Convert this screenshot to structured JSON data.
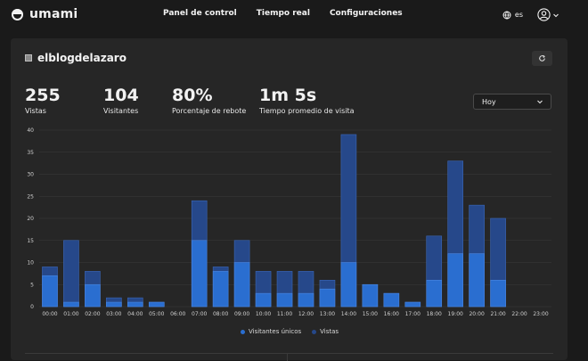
{
  "app": {
    "name": "umami"
  },
  "nav": {
    "items": [
      "Panel de control",
      "Tiempo real",
      "Configuraciones"
    ]
  },
  "tools": {
    "lang": "es"
  },
  "site": {
    "name": "elblogdelazaro"
  },
  "metrics": [
    {
      "value": "255",
      "label": "Vistas"
    },
    {
      "value": "104",
      "label": "Visitantes"
    },
    {
      "value": "80%",
      "label": "Porcentaje de rebote"
    },
    {
      "value": "1m 5s",
      "label": "Tiempo promedio de visita"
    }
  ],
  "range": {
    "selected": "Hoy"
  },
  "colors": {
    "unique": "#2a6ed0",
    "views": "#26488a",
    "grid": "#3a3a3a"
  },
  "chart_data": {
    "type": "bar",
    "categories": [
      "00:00",
      "01:00",
      "02:00",
      "03:00",
      "04:00",
      "05:00",
      "06:00",
      "07:00",
      "08:00",
      "09:00",
      "10:00",
      "11:00",
      "12:00",
      "13:00",
      "14:00",
      "15:00",
      "16:00",
      "17:00",
      "18:00",
      "19:00",
      "20:00",
      "21:00",
      "22:00",
      "23:00"
    ],
    "series": [
      {
        "name": "Visitantes únicos",
        "values": [
          7,
          1,
          5,
          1,
          1,
          1,
          0,
          15,
          8,
          10,
          3,
          3,
          3,
          4,
          10,
          5,
          3,
          1,
          6,
          12,
          12,
          6,
          0,
          0
        ]
      },
      {
        "name": "Vistas",
        "values": [
          9,
          15,
          8,
          2,
          2,
          1,
          0,
          24,
          9,
          15,
          8,
          8,
          8,
          6,
          39,
          5,
          3,
          1,
          16,
          33,
          23,
          20,
          0,
          0
        ]
      }
    ],
    "yticks": [
      0,
      5,
      10,
      15,
      20,
      25,
      30,
      35,
      40
    ],
    "ylim": [
      0,
      40
    ],
    "grid": true,
    "legend": "bottom-center"
  }
}
